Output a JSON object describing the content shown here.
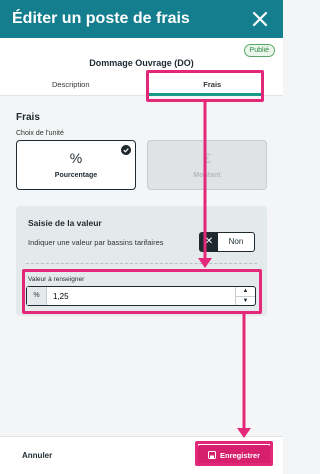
{
  "header": {
    "title": "Éditer un poste de frais"
  },
  "status_badge": "Publié",
  "doc_title": "Dommage Ouvrage (DO)",
  "tabs": [
    {
      "label": "Description"
    },
    {
      "label": "Frais"
    }
  ],
  "section": {
    "title": "Frais",
    "unit_label": "Choix de l’unité",
    "options": [
      {
        "label": "Pourcentage",
        "glyph": "%"
      },
      {
        "label": "Montant",
        "glyph": "€"
      }
    ]
  },
  "panel": {
    "title": "Saisie de la valeur",
    "desc": "Indiquer une valeur par bassins tarifaires",
    "toggle_label": "Non",
    "value_label": "Valeur à renseigner",
    "prefix": "%",
    "value": "1,25"
  },
  "footer": {
    "cancel": "Annuler",
    "save": "Enregistrer"
  },
  "colors": {
    "header": "#147e8f",
    "accent": "#d6206e",
    "tab_underline": "#1a9a89"
  }
}
